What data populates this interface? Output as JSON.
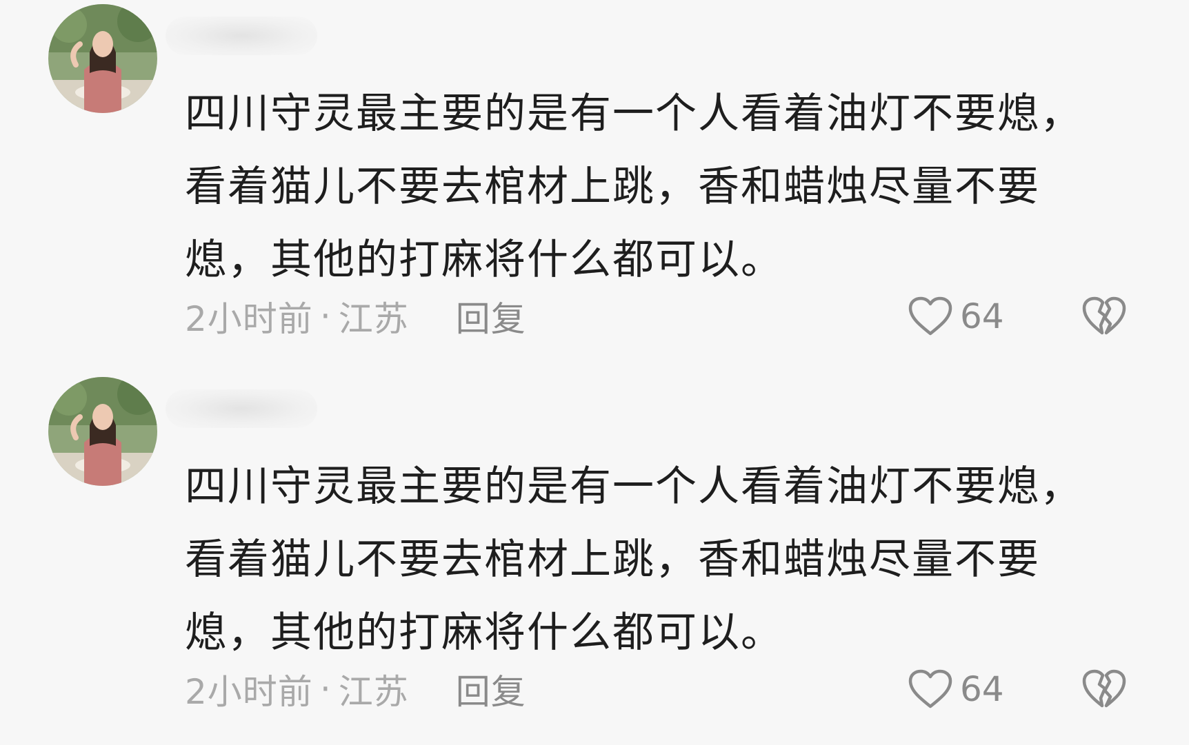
{
  "comments": [
    {
      "text": "四川守灵最主要的是有一个人看着油灯不要熄，看着猫儿不要去棺材上跳，香和蜡烛尽量不要熄，其他的打麻将什么都可以。",
      "time": "2小时前",
      "separator": "·",
      "location": "江苏",
      "reply_label": "回复",
      "like_count": "64",
      "like_icon": "heart-outline-icon",
      "dislike_icon": "broken-heart-icon"
    },
    {
      "text": "四川守灵最主要的是有一个人看着油灯不要熄，看着猫儿不要去棺材上跳，香和蜡烛尽量不要熄，其他的打麻将什么都可以。",
      "time": "2小时前",
      "separator": "·",
      "location": "江苏",
      "reply_label": "回复",
      "like_count": "64",
      "like_icon": "heart-outline-icon",
      "dislike_icon": "broken-heart-icon"
    }
  ],
  "colors": {
    "background": "#f7f7f7",
    "text": "#1e1e1e",
    "meta": "#a9a9a9",
    "icon": "#8a8a8a"
  }
}
